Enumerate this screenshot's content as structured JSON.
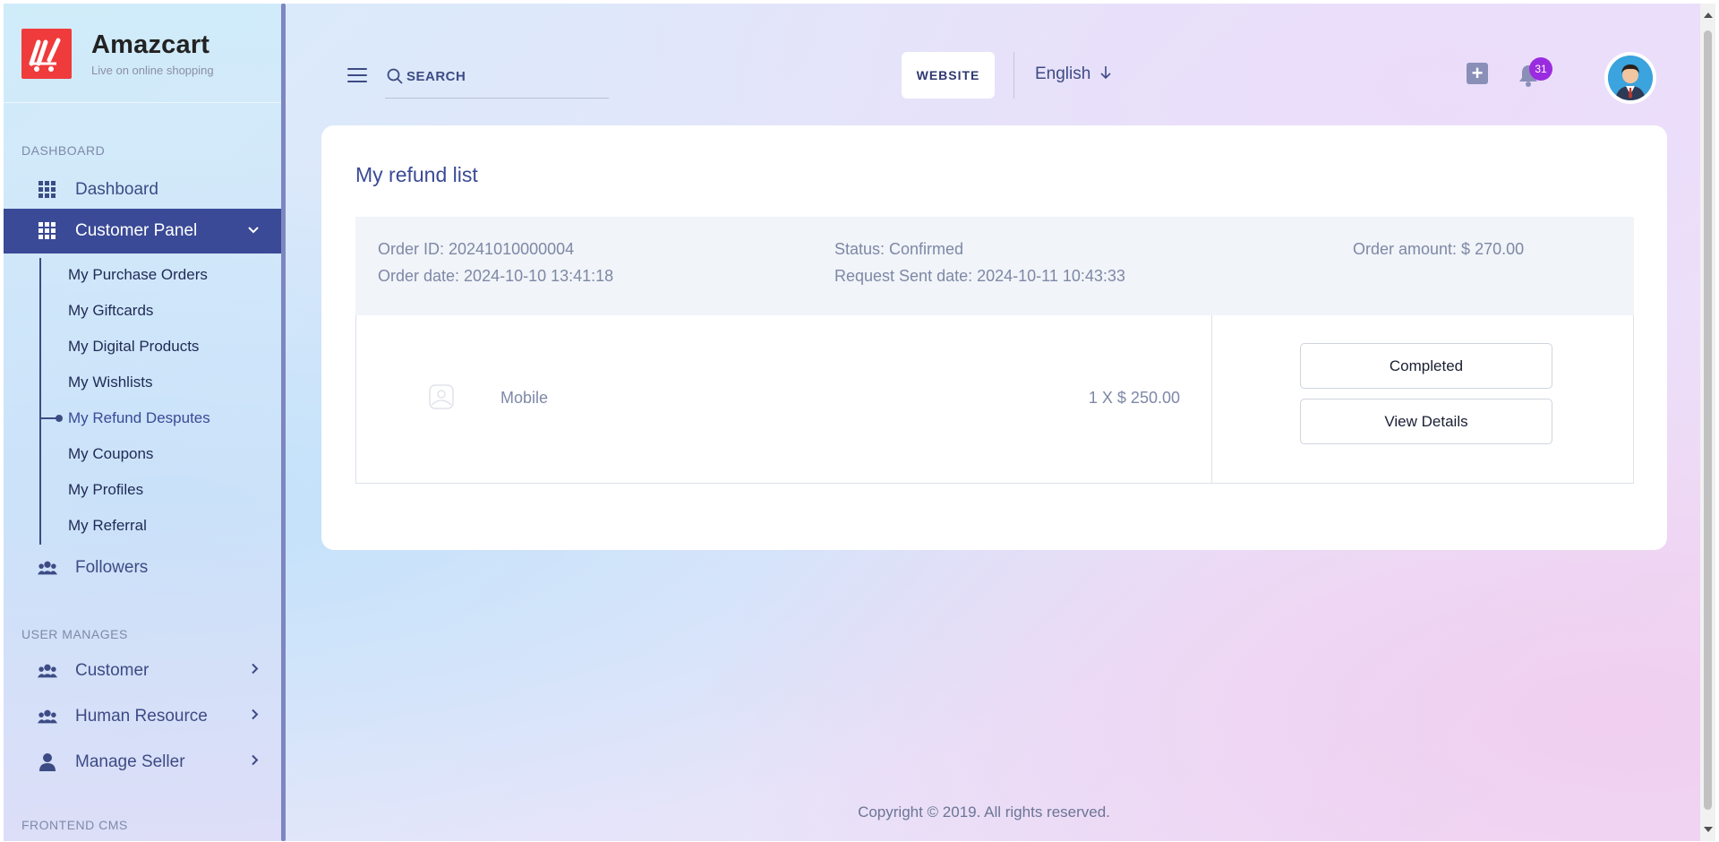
{
  "brand": {
    "name": "Amazcart",
    "tagline": "Live on online shopping"
  },
  "sidebar": {
    "sections": {
      "dashboard": "DASHBOARD",
      "user_manages": "USER MANAGES",
      "frontend_cms": "FRONTEND CMS"
    },
    "items": {
      "dashboard": "Dashboard",
      "customer_panel": "Customer Panel",
      "followers": "Followers",
      "customer": "Customer",
      "human_resource": "Human Resource",
      "manage_seller": "Manage Seller"
    },
    "customer_panel_sub": [
      "My Purchase Orders",
      "My Giftcards",
      "My Digital Products",
      "My Wishlists",
      "My Refund Desputes",
      "My Coupons",
      "My Profiles",
      "My Referral"
    ]
  },
  "header": {
    "search_placeholder": "SEARCH",
    "website_label": "WEBSITE",
    "language": "English",
    "notification_count": "31"
  },
  "main": {
    "title": "My refund list",
    "order": {
      "order_id": "Order ID: 20241010000004",
      "order_date": "Order date: 2024-10-10 13:41:18",
      "status": "Status: Confirmed",
      "request_sent_date": "Request Sent date: 2024-10-11 10:43:33",
      "order_amount": "Order amount: $ 270.00",
      "product_name": "Mobile",
      "product_price": "1 X $ 250.00",
      "completed_label": "Completed",
      "view_details_label": "View Details"
    }
  },
  "footer": {
    "copyright": "Copyright © 2019. All rights reserved."
  },
  "colors": {
    "accent": "#3a4a96",
    "brand_red": "#ef3b3b",
    "badge": "#9a2ce0"
  }
}
